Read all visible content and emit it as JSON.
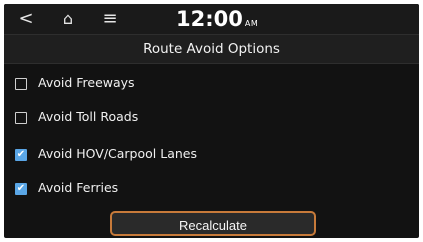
{
  "topbar": {
    "back_icon": "<",
    "home_icon": "⌂",
    "menu_icon": "≡",
    "time": "12:00",
    "ampm": "AM"
  },
  "title": "Route Avoid Options",
  "options": [
    {
      "label": "Avoid Freeways",
      "checked": false
    },
    {
      "label": "Avoid Toll Roads",
      "checked": false
    },
    {
      "label": "Avoid HOV/Carpool Lanes",
      "checked": true
    },
    {
      "label": "Avoid Ferries",
      "checked": true
    }
  ],
  "recalculate_label": "Recalculate",
  "colors": {
    "check_accent": "#5aa6e6",
    "button_border": "#c77a3a"
  }
}
